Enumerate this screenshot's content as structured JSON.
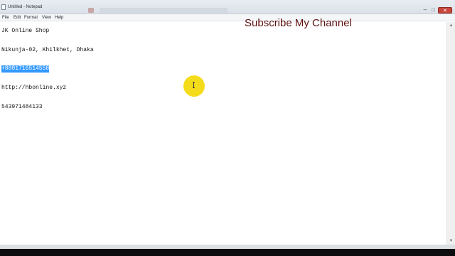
{
  "window": {
    "title": "Untitled - Notepad",
    "minimize_glyph": "─",
    "maximize_glyph": "□",
    "close_glyph": "✕"
  },
  "menu": {
    "items": [
      "File",
      "Edit",
      "Format",
      "View",
      "Help"
    ]
  },
  "document": {
    "lines": [
      "JK Online Shop",
      "Nikunja-02, Khilkhet, Dhaka",
      "+8801716514558",
      "http://hbonline.xyz",
      "543971484133"
    ],
    "selected_line_index": 2
  },
  "overlay": {
    "text": "Subscribe My Channel",
    "color": "#5e1010"
  },
  "cursor": {
    "highlight_color": "#f4dc1b"
  },
  "scrollbar": {
    "up_glyph": "▲",
    "down_glyph": "▼"
  },
  "colors": {
    "selection": "#3399ff",
    "close_button": "#c9463d"
  }
}
